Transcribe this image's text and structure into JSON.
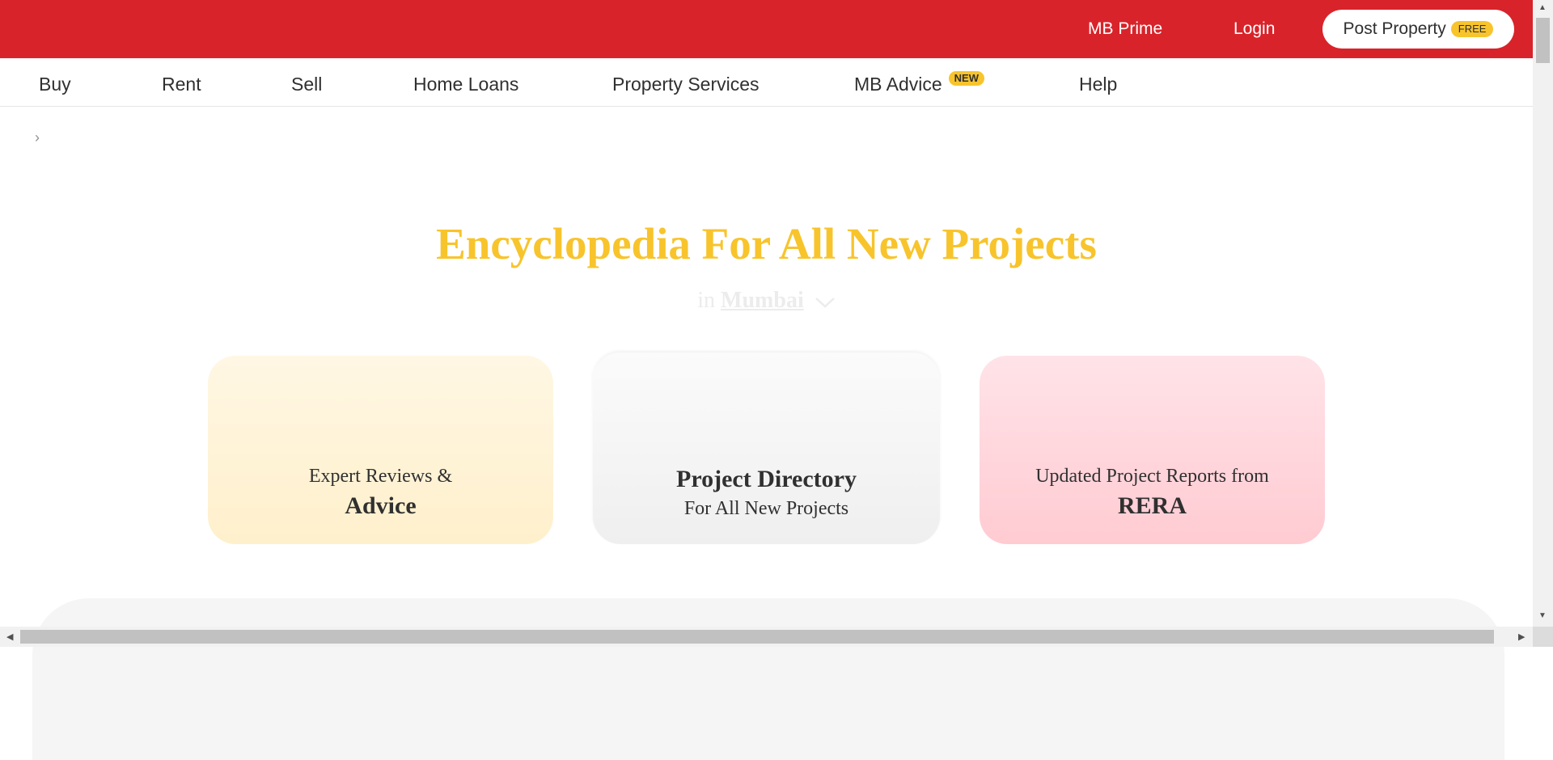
{
  "topbar": {
    "mb_prime": "MB Prime",
    "login": "Login",
    "post_property": "Post Property",
    "post_badge": "FREE",
    "bg_color": "#d8232a"
  },
  "nav": {
    "items": [
      {
        "label": "Buy"
      },
      {
        "label": "Rent"
      },
      {
        "label": "Sell"
      },
      {
        "label": "Home Loans"
      },
      {
        "label": "Property Services"
      },
      {
        "label": "MB Advice",
        "badge": "NEW"
      },
      {
        "label": "Help"
      }
    ]
  },
  "breadcrumb": {
    "separator": "›"
  },
  "hero": {
    "title": "Encyclopedia For All New Projects",
    "in_text": "in",
    "city": "Mumbai",
    "title_color": "#f8c42c"
  },
  "cards": [
    {
      "small": "Expert Reviews &",
      "big": "Advice"
    },
    {
      "big": "Project Directory",
      "small": "For All New Projects"
    },
    {
      "small": "Updated Project Reports from",
      "big": "RERA"
    }
  ],
  "icons": {
    "city_dropdown": "chevron-down-icon",
    "breadcrumb": "chevron-right-icon"
  }
}
